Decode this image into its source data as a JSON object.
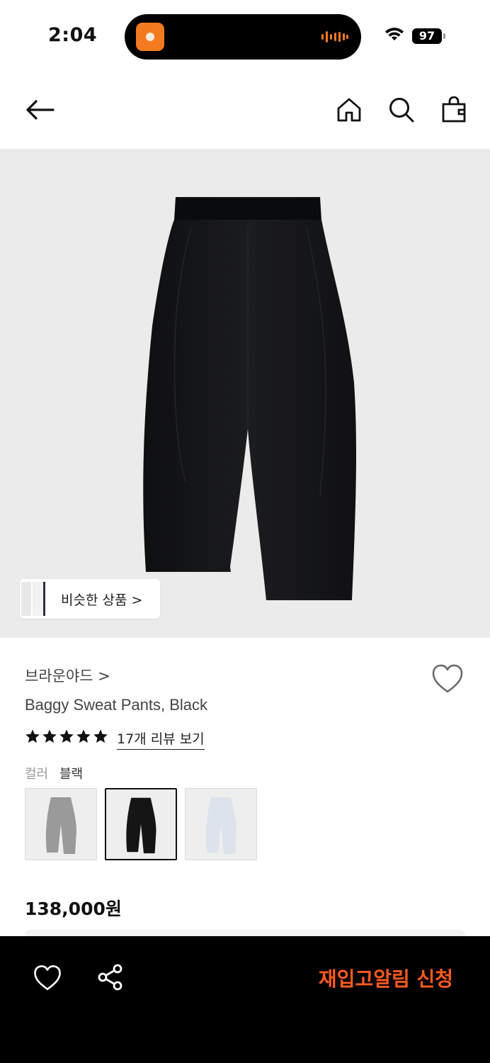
{
  "status_bar": {
    "time": "2:04",
    "battery": "97",
    "icons": [
      "wifi-icon",
      "battery-icon",
      "now-playing-app-icon",
      "audio-wave-icon"
    ]
  },
  "header": {
    "icons": [
      "back-arrow-icon",
      "home-icon",
      "search-icon",
      "shopping-bag-icon"
    ]
  },
  "product": {
    "similar_button_label": "비슷한 상품 >",
    "brand": "브라운야드 >",
    "name": "Baggy Sweat Pants, Black",
    "rating_stars": 5,
    "review_link": "17개 리뷰 보기",
    "color_label": "컬러",
    "color_value": "블랙",
    "swatches": [
      {
        "color": "#9a9a9a",
        "selected": false
      },
      {
        "color": "#151515",
        "selected": true
      },
      {
        "color": "#dde3ec",
        "selected": false
      }
    ],
    "price": "138,000원",
    "pants_color": "#141516"
  },
  "bottom_bar": {
    "restock_button": "재입고알림 신청",
    "accent_color": "#ff5a1f",
    "icons": [
      "heart-outline-icon",
      "share-icon"
    ]
  }
}
